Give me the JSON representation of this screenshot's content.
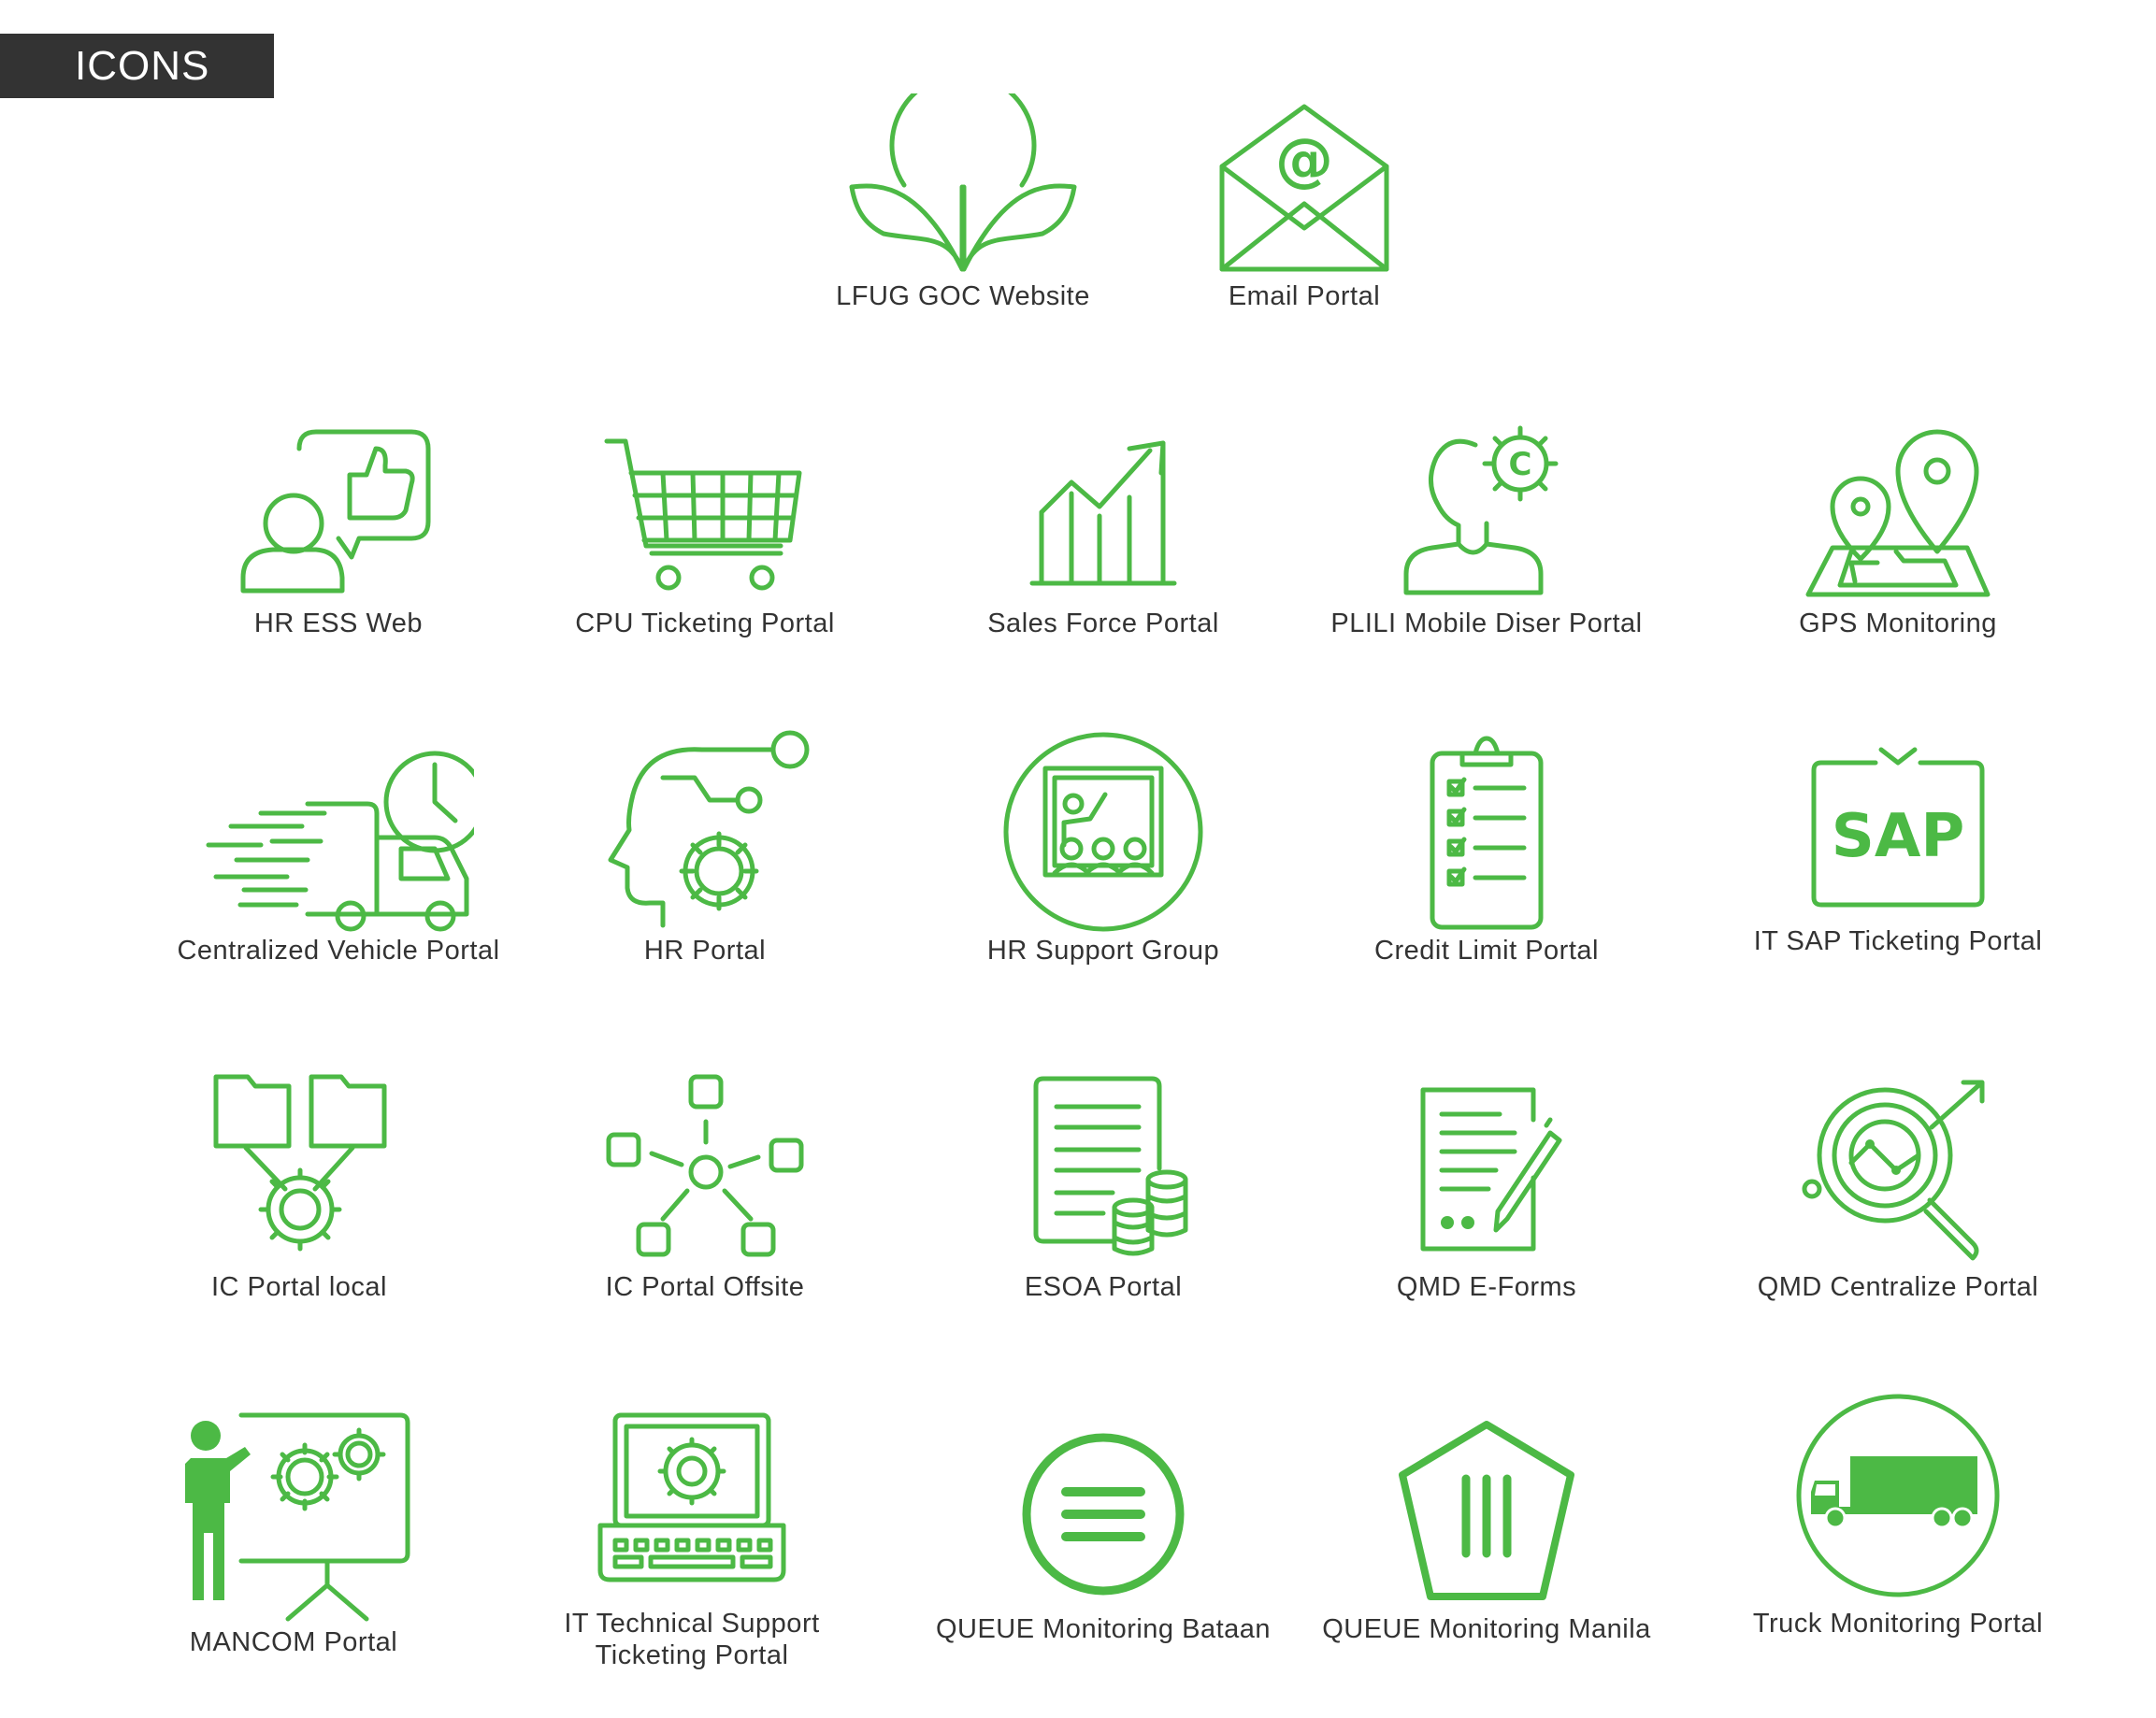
{
  "header": {
    "title": "ICONS"
  },
  "icons": [
    {
      "label": "LFUG GOC Website",
      "icon": "lfug-logo-icon"
    },
    {
      "label": "Email Portal",
      "icon": "email-envelope-icon"
    },
    {
      "label": "HR ESS Web",
      "icon": "person-thumbs-up-chat-icon"
    },
    {
      "label": "CPU Ticketing Portal",
      "icon": "shopping-cart-icon"
    },
    {
      "label": "Sales Force Portal",
      "icon": "bar-chart-growth-icon"
    },
    {
      "label": "PLILI Mobile Diser Portal",
      "icon": "person-gear-icon"
    },
    {
      "label": "GPS Monitoring",
      "icon": "map-pins-icon"
    },
    {
      "label": "Centralized Vehicle Portal",
      "icon": "fast-delivery-truck-icon"
    },
    {
      "label": "HR Portal",
      "icon": "head-gear-network-icon"
    },
    {
      "label": "HR Support Group",
      "icon": "presentation-group-icon"
    },
    {
      "label": "Credit Limit Portal",
      "icon": "clipboard-checklist-icon"
    },
    {
      "label": "IT SAP Ticketing Portal",
      "icon": "sap-frame-icon"
    },
    {
      "label": "IC Portal local",
      "icon": "folders-gear-icon"
    },
    {
      "label": "IC Portal Offsite",
      "icon": "network-nodes-icon"
    },
    {
      "label": "ESOA Portal",
      "icon": "document-coins-icon"
    },
    {
      "label": "QMD E-Forms",
      "icon": "form-pen-icon"
    },
    {
      "label": "QMD Centralize Portal",
      "icon": "magnifier-analytics-icon"
    },
    {
      "label": "MANCOM Portal",
      "icon": "presenter-gears-board-icon"
    },
    {
      "label": "IT Technical Support Ticketing Portal",
      "icon": "laptop-gear-icon"
    },
    {
      "label": "QUEUE Monitoring Bataan",
      "icon": "circle-menu-icon"
    },
    {
      "label": "QUEUE Monitoring Manila",
      "icon": "pentagon-bars-icon"
    },
    {
      "label": "Truck Monitoring Portal",
      "icon": "truck-circle-icon"
    }
  ],
  "colors": {
    "accent": "#4cb945",
    "banner": "#333333",
    "text": "#333333"
  }
}
